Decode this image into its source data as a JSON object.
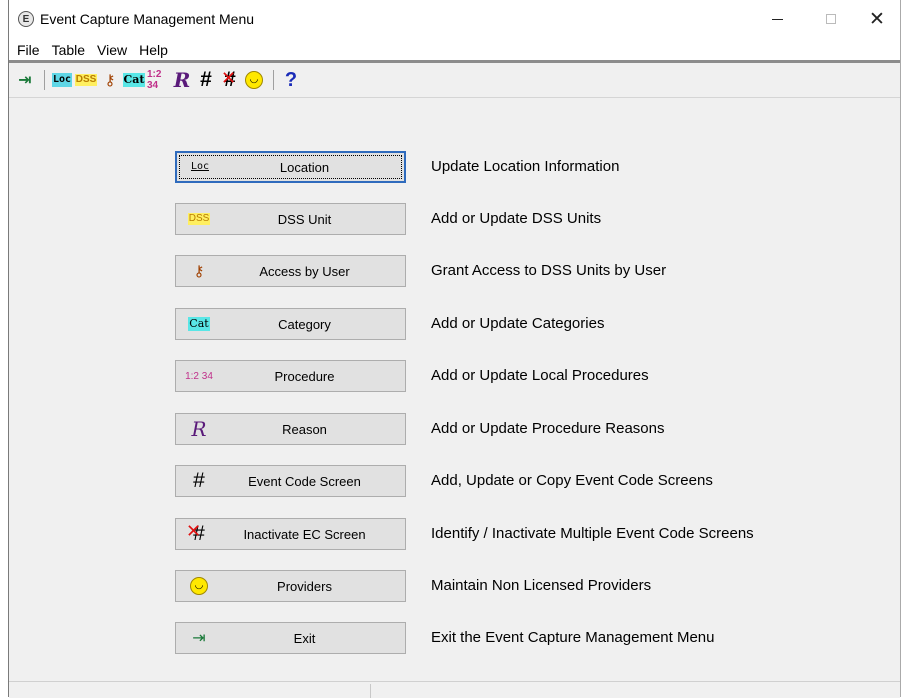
{
  "window": {
    "title": "Event Capture Management Menu"
  },
  "menu": [
    "File",
    "Table",
    "View",
    "Help"
  ],
  "toolbar_icons": [
    "exit-icon",
    "location-icon",
    "dss-unit-icon",
    "access-icon",
    "category-icon",
    "procedure-icon",
    "reason-icon",
    "event-code-screen-icon",
    "inactivate-ec-screen-icon",
    "providers-icon",
    "help-icon"
  ],
  "icons": {
    "loc": "Loc",
    "dss": "DSS",
    "cat": "Cat",
    "proc": "1:2 34",
    "reason": "R",
    "grid": "#",
    "help": "?"
  },
  "buttons": [
    {
      "label": "Location",
      "description": "Update Location Information",
      "icon": "location-icon"
    },
    {
      "label": "DSS Unit",
      "description": "Add or Update DSS Units",
      "icon": "dss-unit-icon"
    },
    {
      "label": "Access by User",
      "description": "Grant Access to DSS Units by User",
      "icon": "access-icon"
    },
    {
      "label": "Category",
      "description": "Add or Update Categories",
      "icon": "category-icon"
    },
    {
      "label": "Procedure",
      "description": "Add or Update Local Procedures",
      "icon": "procedure-icon"
    },
    {
      "label": "Reason",
      "description": "Add or Update Procedure Reasons",
      "icon": "reason-icon"
    },
    {
      "label": "Event Code Screen",
      "description": "Add, Update or Copy Event Code Screens",
      "icon": "event-code-screen-icon"
    },
    {
      "label": "Inactivate EC Screen",
      "description": "Identify / Inactivate Multiple Event Code Screens",
      "icon": "inactivate-ec-screen-icon"
    },
    {
      "label": "Providers",
      "description": "Maintain Non Licensed Providers",
      "icon": "providers-icon"
    },
    {
      "label": "Exit",
      "description": "Exit the Event Capture Management Menu",
      "icon": "exit-icon"
    }
  ],
  "colors": {
    "focus_border": "#2f6bbd",
    "button_face": "#e1e1e1",
    "window_bg": "#f0f0f0"
  }
}
